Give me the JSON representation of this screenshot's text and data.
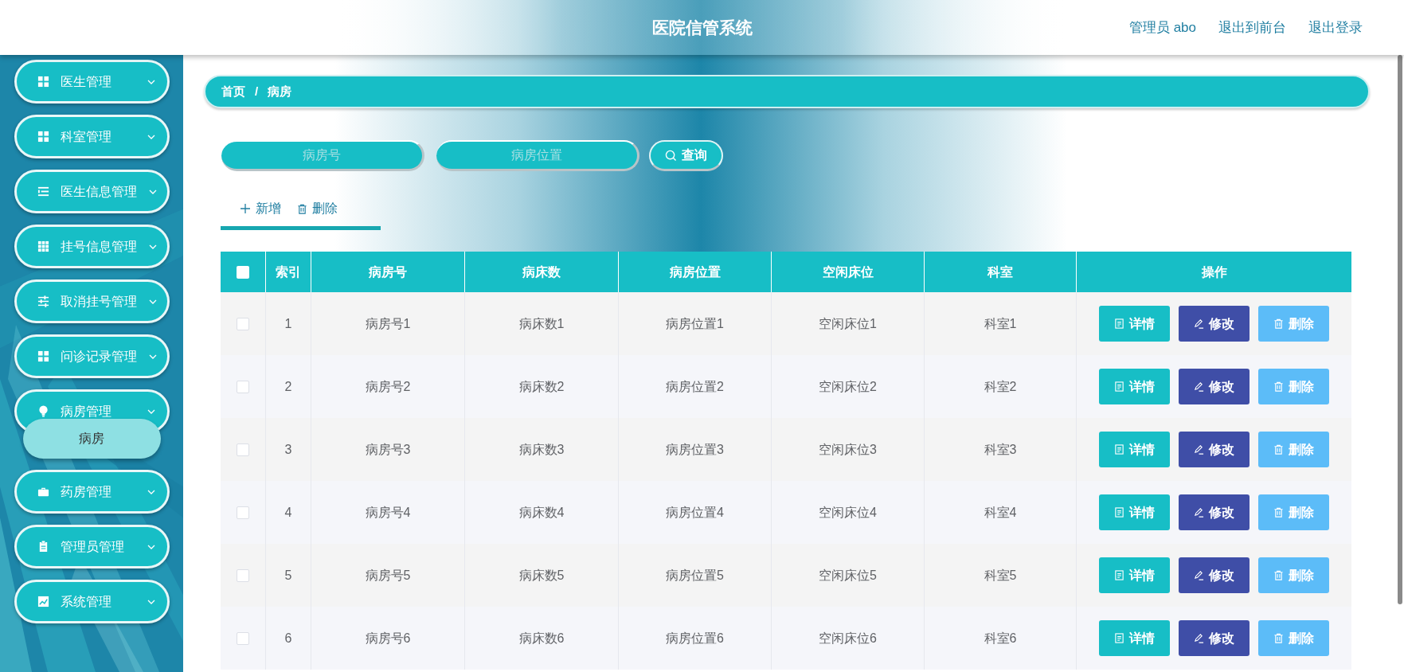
{
  "header": {
    "title": "医院信管系统",
    "links": [
      {
        "label": "管理员 abo"
      },
      {
        "label": "退出到前台"
      },
      {
        "label": "退出登录"
      }
    ]
  },
  "sidebar": {
    "items": [
      {
        "label": "医生管理",
        "kind": "grid",
        "expanded": false
      },
      {
        "label": "科室管理",
        "kind": "grid",
        "expanded": false
      },
      {
        "label": "医生信息管理",
        "kind": "list",
        "expanded": false
      },
      {
        "label": "挂号信息管理",
        "kind": "grid9",
        "expanded": false
      },
      {
        "label": "取消挂号管理",
        "kind": "sliders",
        "expanded": false
      },
      {
        "label": "问诊记录管理",
        "kind": "grid",
        "expanded": false
      },
      {
        "label": "病房管理",
        "kind": "bulb",
        "expanded": true,
        "children": [
          {
            "label": "病房",
            "selected": true
          }
        ]
      },
      {
        "label": "药房管理",
        "kind": "case",
        "expanded": false
      },
      {
        "label": "管理员管理",
        "kind": "clipboard",
        "expanded": false
      },
      {
        "label": "系统管理",
        "kind": "chart",
        "expanded": false
      }
    ]
  },
  "breadcrumb": [
    "首页",
    "/",
    "病房"
  ],
  "search": {
    "fields": [
      {
        "placeholder": "病房号"
      },
      {
        "placeholder": "病房位置"
      }
    ],
    "button": "查询"
  },
  "actions": [
    {
      "kind": "add",
      "label": "新增"
    },
    {
      "kind": "delete",
      "label": "删除"
    }
  ],
  "table": {
    "select_all": false,
    "columns": [
      "索引",
      "病房号",
      "病床数",
      "病房位置",
      "空闲床位",
      "科室",
      "操作"
    ],
    "rows": [
      {
        "checked": false,
        "cells": [
          "1",
          "病房号1",
          "病床数1",
          "病房位置1",
          "空闲床位1",
          "科室1"
        ],
        "buttons": [
          {
            "kind": "detail",
            "label": "详情"
          },
          {
            "kind": "edit",
            "label": "修改"
          },
          {
            "kind": "delete",
            "label": "删除"
          }
        ]
      },
      {
        "checked": false,
        "cells": [
          "2",
          "病房号2",
          "病床数2",
          "病房位置2",
          "空闲床位2",
          "科室2"
        ],
        "buttons": [
          {
            "kind": "detail",
            "label": "详情"
          },
          {
            "kind": "edit",
            "label": "修改"
          },
          {
            "kind": "delete",
            "label": "删除"
          }
        ]
      },
      {
        "checked": false,
        "cells": [
          "3",
          "病房号3",
          "病床数3",
          "病房位置3",
          "空闲床位3",
          "科室3"
        ],
        "buttons": [
          {
            "kind": "detail",
            "label": "详情"
          },
          {
            "kind": "edit",
            "label": "修改"
          },
          {
            "kind": "delete",
            "label": "删除"
          }
        ]
      },
      {
        "checked": false,
        "cells": [
          "4",
          "病房号4",
          "病床数4",
          "病房位置4",
          "空闲床位4",
          "科室4"
        ],
        "buttons": [
          {
            "kind": "detail",
            "label": "详情"
          },
          {
            "kind": "edit",
            "label": "修改"
          },
          {
            "kind": "delete",
            "label": "删除"
          }
        ]
      },
      {
        "checked": false,
        "cells": [
          "5",
          "病房号5",
          "病床数5",
          "病房位置5",
          "空闲床位5",
          "科室5"
        ],
        "buttons": [
          {
            "kind": "detail",
            "label": "详情"
          },
          {
            "kind": "edit",
            "label": "修改"
          },
          {
            "kind": "delete",
            "label": "删除"
          }
        ]
      },
      {
        "checked": false,
        "cells": [
          "6",
          "病房号6",
          "病床数6",
          "病房位置6",
          "空闲床位6",
          "科室6"
        ],
        "buttons": [
          {
            "kind": "detail",
            "label": "详情"
          },
          {
            "kind": "edit",
            "label": "修改"
          },
          {
            "kind": "delete",
            "label": "删除"
          }
        ]
      }
    ]
  }
}
